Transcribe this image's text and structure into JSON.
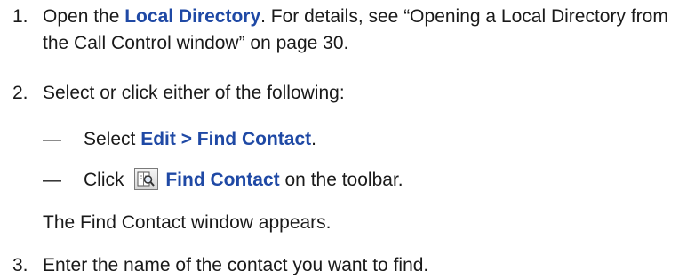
{
  "steps": [
    {
      "number": "1.",
      "text_before": "Open the ",
      "link": "Local Directory",
      "text_after": ". For details, see “Opening a Local Directory from the Call Control window” on page 30."
    },
    {
      "number": "2.",
      "text": "Select or click either of the following:",
      "options": [
        {
          "dash": "—",
          "prefix": "Select ",
          "menu_path": "Edit > Find Contact",
          "suffix": "."
        },
        {
          "dash": "—",
          "prefix": "Click ",
          "icon": "find-contact-icon",
          "button_label": "Find Contact",
          "suffix": " on the toolbar."
        }
      ],
      "result": "The Find Contact window appears."
    },
    {
      "number": "3.",
      "text": "Enter the name of the contact you want to find."
    }
  ],
  "colors": {
    "ui_element": "#1f49a5",
    "body_text": "#1a1a1a"
  }
}
